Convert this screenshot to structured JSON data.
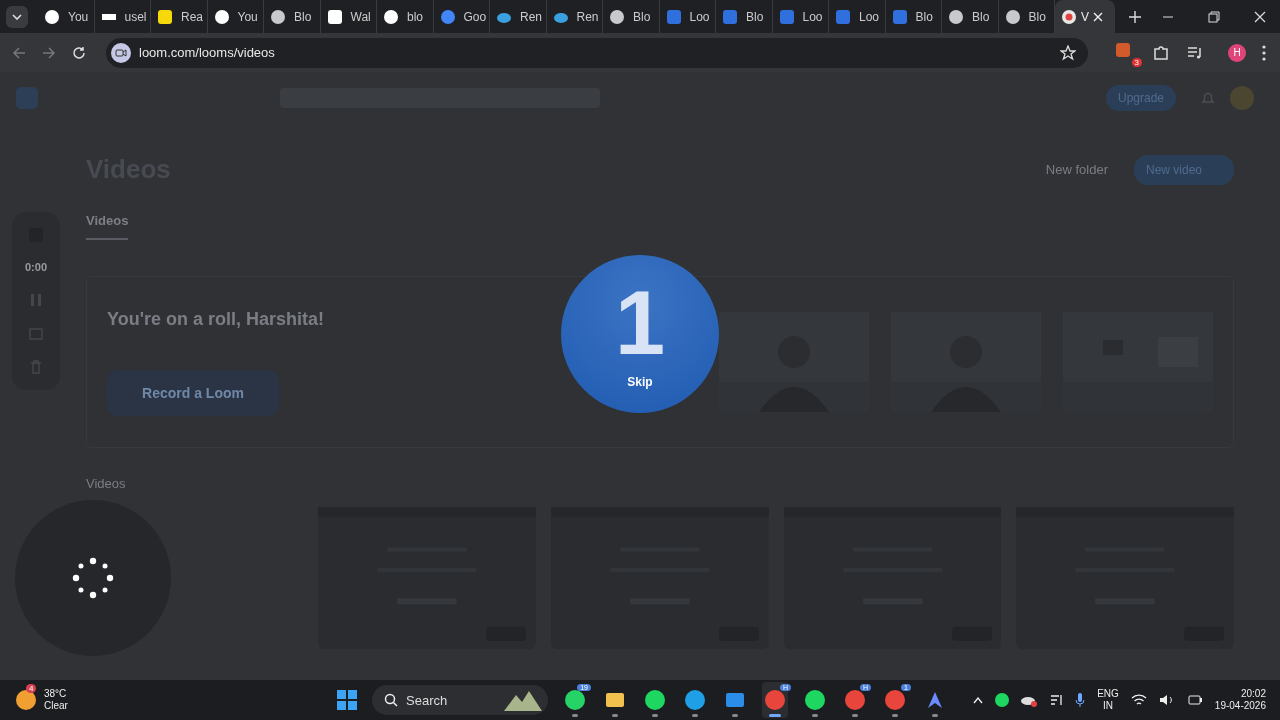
{
  "browser": {
    "tabs": [
      {
        "label": "You",
        "selected": false
      },
      {
        "label": "usel",
        "selected": false
      },
      {
        "label": "Rea",
        "selected": false
      },
      {
        "label": "You",
        "selected": false
      },
      {
        "label": "Blo",
        "selected": false
      },
      {
        "label": "Wal",
        "selected": false
      },
      {
        "label": "blo",
        "selected": false
      },
      {
        "label": "Goo",
        "selected": false
      },
      {
        "label": "Ren",
        "selected": false
      },
      {
        "label": "Ren",
        "selected": false
      },
      {
        "label": "Blo",
        "selected": false
      },
      {
        "label": "Loo",
        "selected": false
      },
      {
        "label": "Blo",
        "selected": false
      },
      {
        "label": "Loo",
        "selected": false
      },
      {
        "label": "Loo",
        "selected": false
      },
      {
        "label": "Blo",
        "selected": false
      },
      {
        "label": "Blo",
        "selected": false
      },
      {
        "label": "Blo",
        "selected": false
      },
      {
        "label": "V",
        "selected": true
      }
    ],
    "url": "loom.com/looms/videos",
    "extension_badge": "3",
    "profile_initial": "H"
  },
  "page": {
    "upgrade": "Upgrade",
    "title": "Videos",
    "actions": [
      "New folder",
      "New video"
    ],
    "tabs": [
      {
        "label": "Videos",
        "selected": true
      }
    ],
    "banner": {
      "heading": "You're on a roll, Harshita!",
      "button": "Record a Loom"
    },
    "section": "Videos"
  },
  "recorder": {
    "time": "0:00"
  },
  "countdown": {
    "number": "1",
    "skip": "Skip"
  },
  "taskbar": {
    "weather": {
      "badge": "4",
      "temp": "38°C",
      "condition": "Clear"
    },
    "search": "Search",
    "apps": [
      {
        "badge": "19",
        "selected": false
      },
      {
        "selected": false
      },
      {
        "selected": false
      },
      {
        "selected": false
      },
      {
        "selected": false
      },
      {
        "badge": "H",
        "selected": true
      },
      {
        "selected": false
      },
      {
        "badge": "H",
        "selected": false
      },
      {
        "badge": "1",
        "selected": false
      },
      {
        "selected": false
      }
    ],
    "lang": [
      "ENG",
      "IN"
    ],
    "time": "20:02",
    "date": "19-04-2026"
  }
}
